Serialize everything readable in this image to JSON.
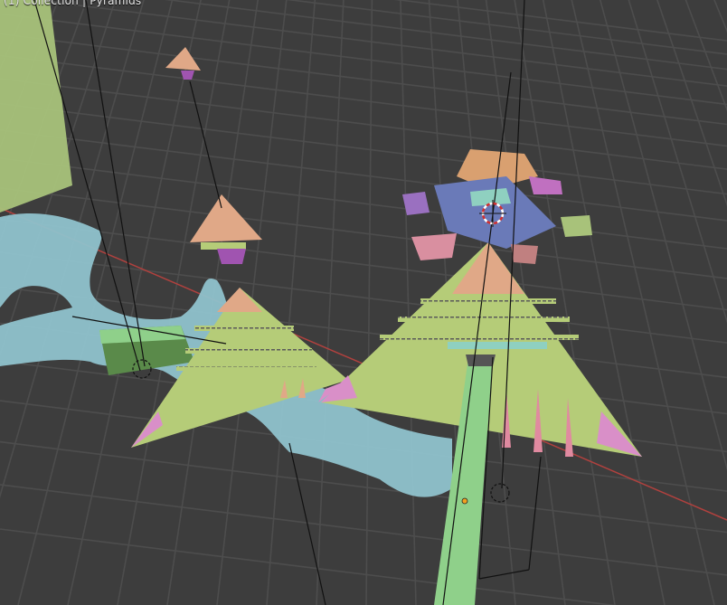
{
  "viewport": {
    "label": "(1) Collection | Pyramids",
    "grid_color": "#4a4a4a",
    "x_axis_color": "#b0413e",
    "background": "#3d3d3d"
  },
  "objects": [
    {
      "name": "ground-plane",
      "color": "#a8c27a"
    },
    {
      "name": "cloth-ribbon",
      "color": "#8fc2cc"
    },
    {
      "name": "pyramid-left",
      "color": "#b5cc78"
    },
    {
      "name": "pyramid-right",
      "color": "#b5cc78"
    },
    {
      "name": "pyramid-small-floating",
      "color": "#e0a887"
    },
    {
      "name": "pyramid-tiny-top",
      "color": "#e0a887"
    },
    {
      "name": "exploded-island",
      "color": "#6a7ab8"
    },
    {
      "name": "walkway",
      "color": "#8fd08a"
    },
    {
      "name": "left-platform",
      "color": "#5a8a4a"
    }
  ],
  "empties": [
    {
      "name": "empty-left",
      "type": "empty"
    },
    {
      "name": "empty-right",
      "type": "empty"
    }
  ],
  "cursor": {
    "name": "3d-cursor"
  },
  "origin_color": "#f0a020"
}
